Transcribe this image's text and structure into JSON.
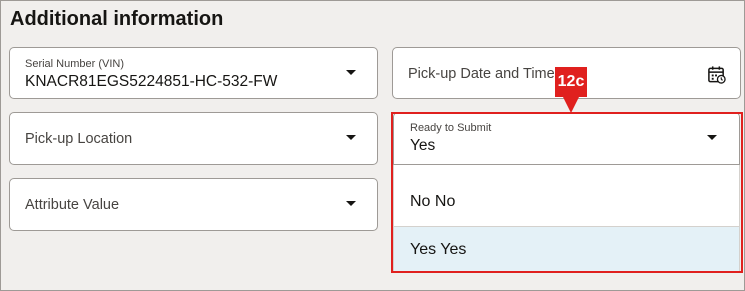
{
  "section": {
    "title": "Additional information"
  },
  "fields": {
    "serial_number": {
      "label": "Serial Number (VIN)",
      "value": "KNACR81EGS5224851-HC-532-FW"
    },
    "pickup_datetime": {
      "placeholder": "Pick-up Date and Time"
    },
    "pickup_location": {
      "placeholder": "Pick-up Location"
    },
    "ready_to_submit": {
      "label": "Ready to Submit",
      "value": "Yes",
      "options": [
        "No No",
        "Yes Yes"
      ],
      "selected_option": "Yes Yes"
    },
    "attribute_value": {
      "placeholder": "Attribute Value"
    }
  },
  "annotation": {
    "callout_label": "12c",
    "color": "#e0201e"
  },
  "icons": {
    "calendar": "calendar-icon",
    "dropdown": "chevron-down-icon"
  }
}
